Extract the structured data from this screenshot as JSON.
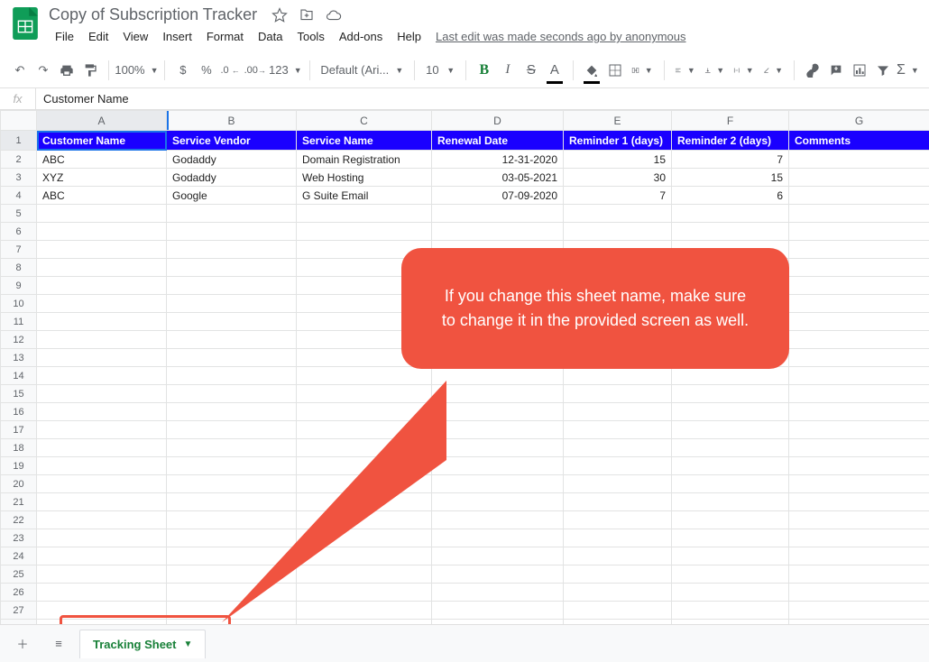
{
  "doc": {
    "title": "Copy of Subscription Tracker"
  },
  "menubar": {
    "file": "File",
    "edit": "Edit",
    "view": "View",
    "insert": "Insert",
    "format": "Format",
    "data": "Data",
    "tools": "Tools",
    "addons": "Add-ons",
    "help": "Help",
    "last_edit": "Last edit was made seconds ago by anonymous"
  },
  "toolbar": {
    "zoom": "100%",
    "currency": "$",
    "percent": "%",
    "dec_dec": ".0",
    "inc_dec": ".00",
    "more_fmt": "123",
    "font_family": "Default (Ari...",
    "font_size": "10",
    "bold": "B",
    "italic": "I",
    "strike": "S",
    "text_color": "A"
  },
  "formula": {
    "fx_label": "fx",
    "value": "Customer Name"
  },
  "columns": [
    "A",
    "B",
    "C",
    "D",
    "E",
    "F",
    "G"
  ],
  "headers": {
    "A": "Customer Name",
    "B": "Service Vendor",
    "C": "Service Name",
    "D": "Renewal Date",
    "E": "Reminder 1 (days)",
    "F": "Reminder 2 (days)",
    "G": "Comments"
  },
  "rows": [
    {
      "A": "ABC",
      "B": "Godaddy",
      "C": "Domain Registration",
      "D": "12-31-2020",
      "E": "15",
      "F": "7",
      "G": ""
    },
    {
      "A": "XYZ",
      "B": "Godaddy",
      "C": "Web Hosting",
      "D": "03-05-2021",
      "E": "30",
      "F": "15",
      "G": ""
    },
    {
      "A": "ABC",
      "B": "Google",
      "C": "G Suite Email",
      "D": "07-09-2020",
      "E": "7",
      "F": "6",
      "G": ""
    }
  ],
  "sheet_tab": "Tracking Sheet",
  "callout_text": "If you change this sheet name, make sure to change it in the provided screen as well."
}
